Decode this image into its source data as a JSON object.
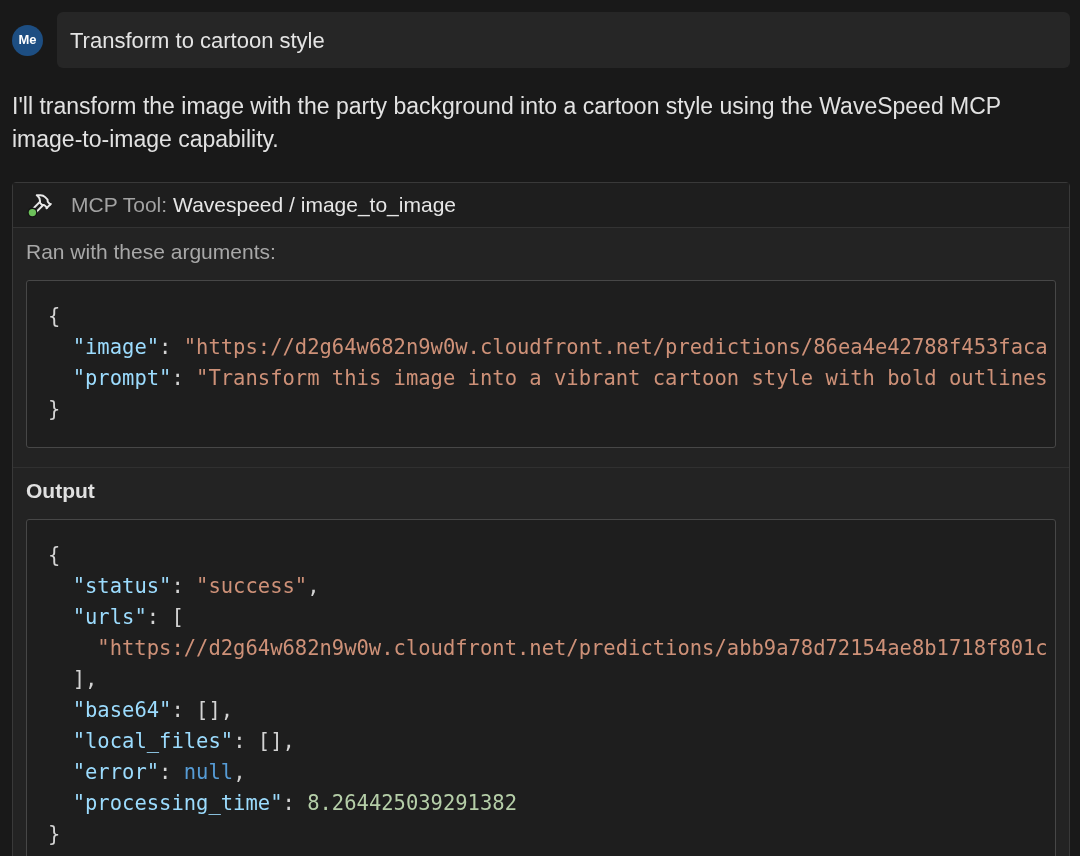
{
  "message": {
    "avatar": "Me",
    "text": "Transform to cartoon style"
  },
  "reply": "I'll transform the image with the party background into a cartoon style using the WaveSpeed MCP image-to-image capability.",
  "tool_call": {
    "label": "MCP Tool:",
    "name": "Wavespeed / image_to_image",
    "arguments": {
      "title": "Ran with these arguments:",
      "lines": [
        {
          "tokens": [
            {
              "kind": "punct",
              "text": "{"
            }
          ],
          "children": [
            {
              "tokens": [
                {
                  "kind": "key",
                  "text": "\"image\""
                },
                {
                  "kind": "sep",
                  "text": ":"
                },
                {
                  "kind": "string",
                  "text": "\"https://d2g64w682n9w0w.cloudfront.net/predictions/86ea4e42788f453faca"
                }
              ]
            },
            {
              "tokens": [
                {
                  "kind": "key",
                  "text": "\"prompt\""
                },
                {
                  "kind": "sep",
                  "text": ":"
                },
                {
                  "kind": "string",
                  "text": "\"Transform this image into a vibrant cartoon style with bold outlines"
                }
              ]
            }
          ]
        },
        {
          "tokens": [
            {
              "kind": "punct",
              "text": "}"
            }
          ]
        }
      ]
    },
    "output": {
      "title": "Output",
      "lines": [
        {
          "tokens": [
            {
              "kind": "punct",
              "text": "{"
            }
          ],
          "children": [
            {
              "tokens": [
                {
                  "kind": "key",
                  "text": "\"status\""
                },
                {
                  "kind": "sep",
                  "text": ":"
                },
                {
                  "kind": "string",
                  "text": "\"success\""
                },
                {
                  "kind": "punct",
                  "text": ","
                }
              ]
            },
            {
              "tokens": [
                {
                  "kind": "key",
                  "text": "\"urls\""
                },
                {
                  "kind": "sep",
                  "text": ":"
                },
                {
                  "kind": "punct",
                  "text": "["
                }
              ],
              "children": [
                {
                  "tokens": [
                    {
                      "kind": "string",
                      "text": "\"https://d2g64w682n9w0w.cloudfront.net/predictions/abb9a78d72154ae8b1718f801c"
                    }
                  ]
                }
              ]
            },
            {
              "tokens": [
                {
                  "kind": "punct",
                  "text": "],"
                }
              ]
            },
            {
              "tokens": [
                {
                  "kind": "key",
                  "text": "\"base64\""
                },
                {
                  "kind": "sep",
                  "text": ":"
                },
                {
                  "kind": "punct",
                  "text": "[],"
                }
              ]
            },
            {
              "tokens": [
                {
                  "kind": "key",
                  "text": "\"local_files\""
                },
                {
                  "kind": "sep",
                  "text": ":"
                },
                {
                  "kind": "punct",
                  "text": "[],"
                }
              ]
            },
            {
              "tokens": [
                {
                  "kind": "key",
                  "text": "\"error\""
                },
                {
                  "kind": "sep",
                  "text": ":"
                },
                {
                  "kind": "null",
                  "text": "null"
                },
                {
                  "kind": "punct",
                  "text": ","
                }
              ]
            },
            {
              "tokens": [
                {
                  "kind": "key",
                  "text": "\"processing_time\""
                },
                {
                  "kind": "sep",
                  "text": ":"
                },
                {
                  "kind": "number",
                  "text": "8.264425039291382"
                }
              ]
            }
          ]
        },
        {
          "tokens": [
            {
              "kind": "punct",
              "text": "}"
            }
          ]
        }
      ]
    }
  }
}
